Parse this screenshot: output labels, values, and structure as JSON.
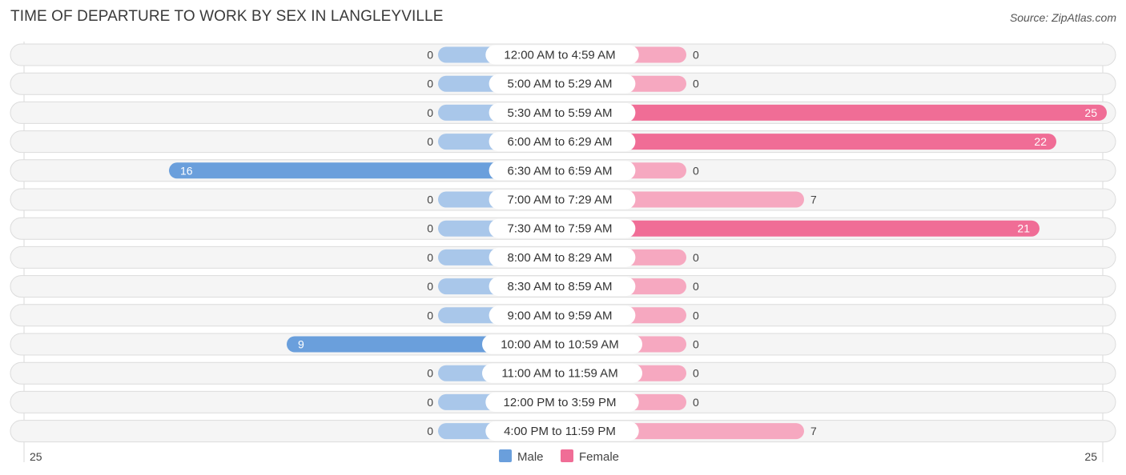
{
  "title": "TIME OF DEPARTURE TO WORK BY SEX IN LANGLEYVILLE",
  "source": "Source: ZipAtlas.com",
  "colors": {
    "male_strong": "#6a9fdc",
    "male_light": "#a9c7ea",
    "female_strong": "#f06d96",
    "female_light": "#f6a8c0"
  },
  "chart_data": {
    "type": "bar",
    "orientation": "horizontal-diverging",
    "title": "TIME OF DEPARTURE TO WORK BY SEX IN LANGLEYVILLE",
    "categories": [
      "12:00 AM to 4:59 AM",
      "5:00 AM to 5:29 AM",
      "5:30 AM to 5:59 AM",
      "6:00 AM to 6:29 AM",
      "6:30 AM to 6:59 AM",
      "7:00 AM to 7:29 AM",
      "7:30 AM to 7:59 AM",
      "8:00 AM to 8:29 AM",
      "8:30 AM to 8:59 AM",
      "9:00 AM to 9:59 AM",
      "10:00 AM to 10:59 AM",
      "11:00 AM to 11:59 AM",
      "12:00 PM to 3:59 PM",
      "4:00 PM to 11:59 PM"
    ],
    "series": [
      {
        "name": "Male",
        "values": [
          0,
          0,
          0,
          0,
          16,
          0,
          0,
          0,
          0,
          0,
          9,
          0,
          0,
          0
        ]
      },
      {
        "name": "Female",
        "values": [
          0,
          0,
          25,
          22,
          0,
          7,
          21,
          0,
          0,
          0,
          0,
          0,
          0,
          7
        ]
      }
    ],
    "axis": {
      "left_max_label": "25",
      "right_max_label": "25",
      "range": [
        0,
        25
      ]
    },
    "legend": {
      "position": "bottom-center",
      "items": [
        "Male",
        "Female"
      ]
    },
    "grid": false
  }
}
